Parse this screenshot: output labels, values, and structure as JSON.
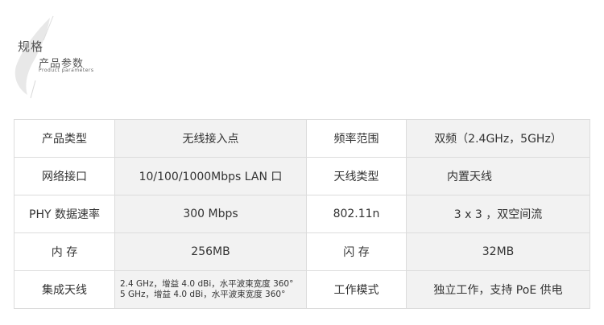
{
  "header": {
    "title": "规格",
    "subtitle": "产品参数",
    "subtitle_en": "Product parameters"
  },
  "table": {
    "rows": [
      {
        "label1": "产品类型",
        "value1": "无线接入点",
        "label2": "频率范围",
        "value2": "双频（2.4GHz，5GHz）"
      },
      {
        "label1": "网络接口",
        "value1": "10/100/1000Mbps LAN 口",
        "label2": "天线类型",
        "value2": "内置天线"
      },
      {
        "label1": "PHY 数据速率",
        "value1": "300 Mbps",
        "label2": "802.11n",
        "value2": "3 x 3 ，双空间流"
      },
      {
        "label1": "内 存",
        "value1": "256MB",
        "label2": "闪 存",
        "value2": "32MB"
      },
      {
        "label1": "集成天线",
        "value1_line1": "2.4 GHz，增益 4.0 dBi，水平波束宽度 360°",
        "value1_line2": "5 GHz，增益 4.0 dBi，水平波束宽度 360°",
        "label2": "工作模式",
        "value2": "独立工作，支持 PoE 供电"
      }
    ]
  },
  "colors": {
    "value_cell_bg": "#f2f2f2",
    "border": "#dcdcdc",
    "text": "#333333"
  }
}
